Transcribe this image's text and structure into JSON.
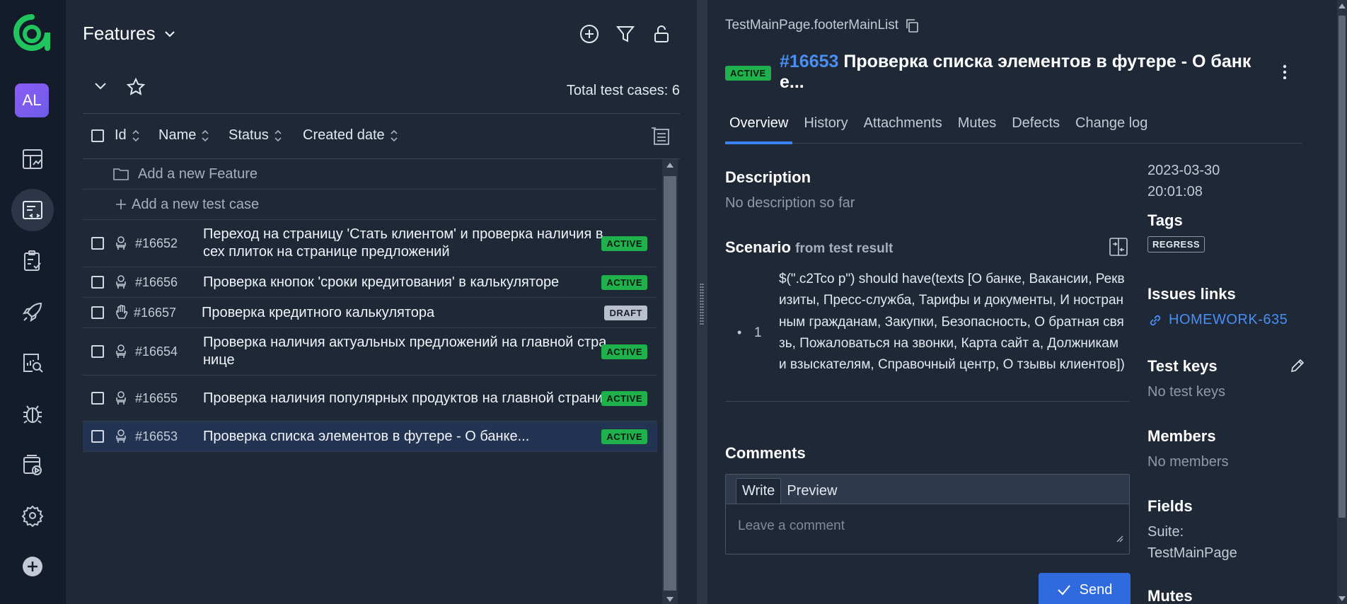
{
  "nav": {
    "avatar_initials": "AL",
    "items": [
      "dashboard-icon",
      "test-cases-icon",
      "test-plans-icon",
      "launches-icon",
      "analytics-icon",
      "defects-icon",
      "jobs-icon",
      "settings-icon",
      "add-project-icon"
    ],
    "active_index": 1
  },
  "list": {
    "title": "Features",
    "total": "Total test cases: 6",
    "columns": [
      "Id",
      "Name",
      "Status",
      "Created date"
    ],
    "add_feature": "Add a new Feature",
    "add_case": "Add a new test case",
    "rows": [
      {
        "id": "#16652",
        "name": "Переход на страницу 'Стать клиентом' и проверка наличия в сех плиток на странице предложений",
        "status": "ACTIVE",
        "icon": "automated-icon"
      },
      {
        "id": "#16656",
        "name": "Проверка кнопок 'сроки кредитования' в калькуляторе",
        "status": "ACTIVE",
        "icon": "automated-icon"
      },
      {
        "id": "#16657",
        "name": "Проверка кредитного калькулятора",
        "status": "DRAFT",
        "icon": "manual-hand-icon"
      },
      {
        "id": "#16654",
        "name": "Проверка наличия актуальных предложений на главной стра нице",
        "status": "ACTIVE",
        "icon": "automated-icon"
      },
      {
        "id": "#16655",
        "name": "Проверка наличия популярных продуктов на главной страни це",
        "status": "ACTIVE",
        "icon": "automated-icon"
      },
      {
        "id": "#16653",
        "name": "Проверка списка элементов в футере - О банке...",
        "status": "ACTIVE",
        "icon": "automated-icon"
      }
    ]
  },
  "detail": {
    "breadcrumb": "TestMainPage.footerMainList",
    "status": "ACTIVE",
    "id": "#16653",
    "title": "Проверка списка элементов в футере - О банк е...",
    "tabs": [
      "Overview",
      "History",
      "Attachments",
      "Mutes",
      "Defects",
      "Change log"
    ],
    "description_heading": "Description",
    "description_text": "No description so far",
    "scenario_heading": "Scenario",
    "scenario_sub": "from test result",
    "step_bullet": "•",
    "step_number": "1",
    "step_text": "$(\".c2Tco p\") should have(texts [О банке, Вакансии, Реквизиты, Пресс-служба, Тарифы и документы, И ностранным гражданам, Закупки, Безопасность, О братная связь, Пожаловаться на звонки, Карта сайт а, Должникам и взыскателям, Справочный центр, О тзывы клиентов])",
    "comments_heading": "Comments",
    "write_tab": "Write",
    "preview_tab": "Preview",
    "comment_placeholder": "Leave a comment",
    "send_label": "Send"
  },
  "side": {
    "created_date": "2023-03-30",
    "created_time": "20:01:08",
    "tags_heading": "Tags",
    "tag": "REGRESS",
    "issues_heading": "Issues links",
    "issue": "HOMEWORK-635",
    "test_keys_heading": "Test keys",
    "test_keys_text": "No test keys",
    "members_heading": "Members",
    "members_text": "No members",
    "fields_heading": "Fields",
    "suite_label": "Suite:",
    "suite_value": "TestMainPage",
    "mutes_heading": "Mutes"
  },
  "colors": {
    "accent": "#3b82f6",
    "active_badge": "#1fb14b",
    "draft_badge": "#b9c0cb",
    "link": "#4a8ff2",
    "logo": "#21c55d"
  }
}
